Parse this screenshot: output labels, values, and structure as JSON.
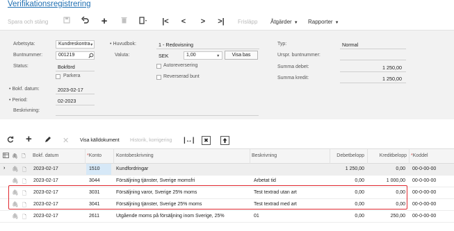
{
  "page": {
    "title": "Verifikationsregistrering"
  },
  "toolbar": {
    "save_close": "Spara och stäng",
    "release": "Frisläpp",
    "actions": "Åtgärder",
    "reports": "Rapporter",
    "icons": [
      "save-icon",
      "undo-icon",
      "plus-icon",
      "trash-icon",
      "copy-paste-icon",
      "first-icon",
      "prev-icon",
      "next-icon",
      "last-icon"
    ]
  },
  "form": {
    "arbetsyta_label": "Arbetsyta:",
    "arbetsyta_value": "Kundreskontra",
    "buntnummer_label": "Buntnummer:",
    "buntnummer_value": "001219",
    "status_label": "Status:",
    "status_value": "Bokförd",
    "parkera_label": "Parkera",
    "bokf_datum_label": "Bokf. datum:",
    "bokf_datum_value": "2023-02-17",
    "period_label": "Period:",
    "period_value": "02-2023",
    "beskrivning_label": "Beskrivning:",
    "huvudbok_label": "Huvudbok:",
    "huvudbok_value": "1 - Redovisning",
    "valuta_label": "Valuta:",
    "valuta_code": "SEK",
    "valuta_rate": "1,00",
    "visa_bas": "Visa bas",
    "autoreversering_label": "Autoreversering",
    "reverserad_bunt_label": "Reverserad bunt",
    "typ_label": "Typ:",
    "typ_value": "Normal",
    "urspr_label": "Urspr. buntnummer:",
    "summa_debet_label": "Summa debet:",
    "summa_debet_value": "1 250,00",
    "summa_kredit_label": "Summa kredit:",
    "summa_kredit_value": "1 250,00"
  },
  "gridtoolbar": {
    "visa_kalldokument": "Visa källdokument",
    "historik": "Historik, korrigering"
  },
  "grid": {
    "headers": {
      "bokf_datum": "Bokf. datum",
      "konto": "Konto",
      "kontobeskrivning": "Kontobeskrivning",
      "beskrivning": "Beskrivning",
      "debetbelopp": "Debetbelopp",
      "kreditbelopp": "Kreditbelopp",
      "koddel": "Koddel"
    },
    "rows": [
      {
        "date": "2023-02-17",
        "konto": "1510",
        "kontobeskrivning": "Kundfordringar",
        "beskrivning": "",
        "debet": "1 250,00",
        "kredit": "0,00",
        "koddel": "00-0-00-00"
      },
      {
        "date": "2023-02-17",
        "konto": "3044",
        "kontobeskrivning": "Försäljning tjänster, Sverige momsfri",
        "beskrivning": "Arbetat tid",
        "debet": "0,00",
        "kredit": "1 000,00",
        "koddel": "00-0-00-00"
      },
      {
        "date": "2023-02-17",
        "konto": "3031",
        "kontobeskrivning": "Försäljning varor, Sverige 25% moms",
        "beskrivning": "Test textrad utan art",
        "debet": "0,00",
        "kredit": "0,00",
        "koddel": "00-0-00-00"
      },
      {
        "date": "2023-02-17",
        "konto": "3041",
        "kontobeskrivning": "Försäljning tjänster, Sverige 25% moms",
        "beskrivning": "Test textrad med art",
        "debet": "0,00",
        "kredit": "0,00",
        "koddel": "00-0-00-00"
      },
      {
        "date": "2023-02-17",
        "konto": "2611",
        "kontobeskrivning": "Utgående moms på försäljning inom Sverige, 25%",
        "beskrivning": "01",
        "debet": "0,00",
        "kredit": "250,00",
        "koddel": "00-0-00-00"
      }
    ]
  },
  "colors": {
    "link": "#1f6fb2",
    "highlight": "#e0282f",
    "selected_cell": "#d6e8f7"
  }
}
